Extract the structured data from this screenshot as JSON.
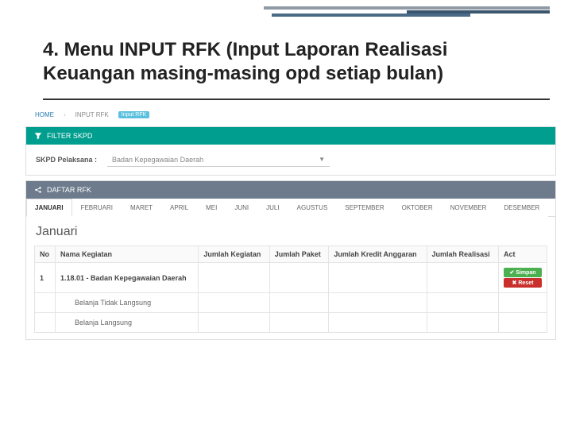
{
  "slide": {
    "title": "4. Menu INPUT RFK (Input Laporan Realisasi Keuangan masing-masing opd setiap bulan)"
  },
  "breadcrumb": {
    "home": "HOME",
    "page": "INPUT RFK",
    "badge": "Input RFK"
  },
  "filterPanel": {
    "title": "FILTER SKPD",
    "label": "SKPD Pelaksana :",
    "value": "Badan Kepegawaian Daerah"
  },
  "listPanel": {
    "title": "DAFTAR RFK"
  },
  "months": [
    "JANUARI",
    "FEBRUARI",
    "MARET",
    "APRIL",
    "MEI",
    "JUNI",
    "JULI",
    "AGUSTUS",
    "SEPTEMBER",
    "OKTOBER",
    "NOVEMBER",
    "DESEMBER"
  ],
  "activeMonth": "Januari",
  "columns": {
    "no": "No",
    "nama": "Nama Kegiatan",
    "jml_keg": "Jumlah Kegiatan",
    "jml_paket": "Jumlah Paket",
    "jml_kredit": "Jumlah Kredit Anggaran",
    "jml_real": "Jumlah Realisasi",
    "act": "Act"
  },
  "rows": {
    "main": {
      "no": "1",
      "nama": "1.18.01 - Badan Kepegawaian Daerah"
    },
    "sub1": "Belanja Tidak Langsung",
    "sub2": "Belanja Langsung"
  },
  "buttons": {
    "save": "✔ Simpan",
    "reset": "✖ Reset"
  }
}
